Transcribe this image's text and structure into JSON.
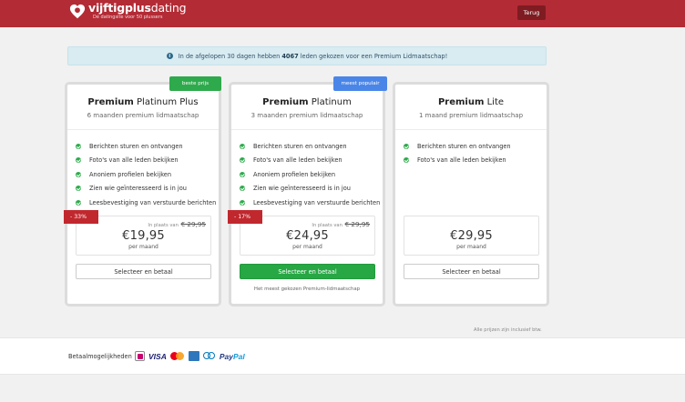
{
  "header": {
    "brand_bold": "vijftigplus",
    "brand_thin": "dating",
    "tagline": "Dé datingsite voor 50 plussers",
    "back_label": "Terug",
    "colors": {
      "header_bg": "#b32b35",
      "back_bg": "#7e1c22"
    }
  },
  "notice": {
    "icon": "info-icon",
    "text_before": "In de afgelopen 30 dagen hebben",
    "count": "4067",
    "text_after": "leden gekozen voor een Premium Lidmaatschap!"
  },
  "plans": [
    {
      "title_bold": "Premium",
      "title_rest": "Platinum Plus",
      "subtitle": "6 maanden premium lidmaatschap",
      "ribbon": "beste prijs",
      "ribbon_color": "#2eaa4c",
      "features": [
        "Berichten sturen en ontvangen",
        "Foto's van alle leden bekijken",
        "Anoniem profielen bekijken",
        "Zien wie geïnteresseerd is in jou",
        "Leesbevestiging van verstuurde berichten"
      ],
      "discount": "- 33%",
      "was_label": "In plaats van",
      "was_price": "€ 29,95",
      "price": "€19,95",
      "per": "per maand",
      "button": "Selecteer en betaal"
    },
    {
      "title_bold": "Premium",
      "title_rest": "Platinum",
      "subtitle": "3 maanden premium lidmaatschap",
      "ribbon": "meest populair",
      "ribbon_color": "#4a86e8",
      "features": [
        "Berichten sturen en ontvangen",
        "Foto's van alle leden bekijken",
        "Anoniem profielen bekijken",
        "Zien wie geïnteresseerd is in jou",
        "Leesbevestiging van verstuurde berichten"
      ],
      "discount": "- 17%",
      "was_label": "In plaats van",
      "was_price": "€ 29,95",
      "price": "€24,95",
      "per": "per maand",
      "button": "Selecteer en betaal",
      "note": "Het meest gekozen Premium-lidmaatschap"
    },
    {
      "title_bold": "Premium",
      "title_rest": "Lite",
      "subtitle": "1 maand premium lidmaatschap",
      "features": [
        "Berichten sturen en ontvangen",
        "Foto's van alle leden bekijken"
      ],
      "price": "€29,95",
      "per": "per maand",
      "button": "Selecteer en betaal"
    }
  ],
  "vat_note": "Alle prijzen zijn inclusief btw.",
  "footer": {
    "payment_label": "Betaalmogelijkheden",
    "visa": "VISA",
    "paypal_a": "Pay",
    "paypal_b": "Pal",
    "icons": [
      "ideal-icon",
      "visa-icon",
      "mastercard-icon",
      "amex-icon",
      "diners-icon",
      "paypal-icon"
    ]
  }
}
